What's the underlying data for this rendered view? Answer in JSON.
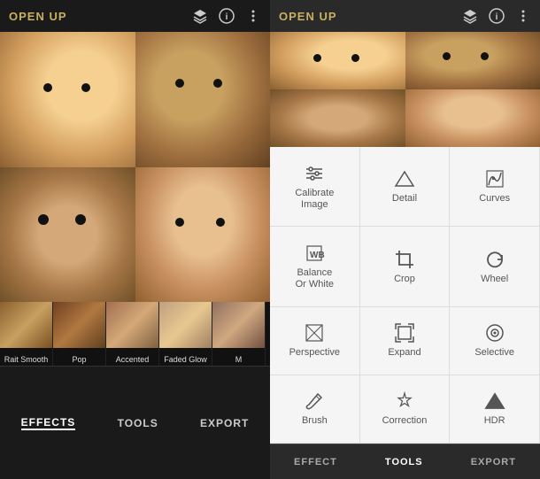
{
  "app": {
    "title": "OPEN UP"
  },
  "left_panel": {
    "top_icons": [
      "layers-icon",
      "info-icon",
      "more-icon"
    ],
    "thumbnails": [
      {
        "label": "Rait Smooth"
      },
      {
        "label": "Pop"
      },
      {
        "label": "Accented"
      },
      {
        "label": "Faded Glow"
      },
      {
        "label": "M"
      }
    ],
    "bottom_tabs": [
      {
        "label": "Effects",
        "active": true
      },
      {
        "label": "TOOLS",
        "active": false
      },
      {
        "label": "EXPORT",
        "active": false
      }
    ]
  },
  "right_panel": {
    "top_icons": [
      "layers-icon",
      "info-icon",
      "more-icon"
    ],
    "tools": [
      {
        "icon": "sliders",
        "label": "Calibrate Image",
        "unicode": "⊞"
      },
      {
        "icon": "triangle-down",
        "label": "Detail",
        "unicode": "▽"
      },
      {
        "icon": "curves",
        "label": "Curves",
        "unicode": "⌇"
      },
      {
        "icon": "wb",
        "label": "Balance Or White",
        "unicode": "⬚"
      },
      {
        "icon": "crop",
        "label": "Crop",
        "unicode": "⬜"
      },
      {
        "icon": "wheel",
        "label": "Wheel",
        "unicode": "↻"
      },
      {
        "icon": "perspective",
        "label": "Perspective",
        "unicode": "⬡"
      },
      {
        "icon": "expand",
        "label": "Expand",
        "unicode": "⊡"
      },
      {
        "icon": "selective",
        "label": "Selective",
        "unicode": "◎"
      },
      {
        "icon": "brush",
        "label": "Brush",
        "unicode": "✏"
      },
      {
        "icon": "correction",
        "label": "Correction",
        "unicode": "✳"
      },
      {
        "icon": "hdr",
        "label": "HDR",
        "unicode": "▲"
      }
    ],
    "bottom_tabs": [
      {
        "label": "EFFECT",
        "active": false
      },
      {
        "label": "TOOLS",
        "active": true
      },
      {
        "label": "EXPORT",
        "active": false
      }
    ]
  }
}
